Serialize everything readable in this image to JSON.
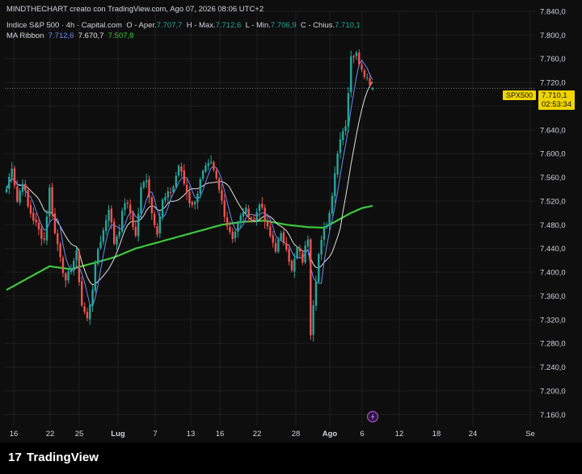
{
  "header": {
    "attribution": "MINDTHECHART creato con TradingView.com, Ago 07, 2026 08:06 UTC+2",
    "symbol": "Indice S&P 500 · 4h · Capital.com",
    "open_label": "O - Aper.",
    "open": "7.707,7",
    "high_label": "H - Max.",
    "high": "7.712,6",
    "low_label": "L - Min.",
    "low": "7.706,9",
    "close_label": "C - Chius.",
    "close": "7.710,1",
    "ma_label": "MA Ribbon",
    "ma1": "7.712,6",
    "ma2": "7.670,7",
    "ma3": "7.507,8"
  },
  "price_tag": {
    "ticker": "SPX500",
    "price": "7.710,1",
    "countdown": "02:53:34"
  },
  "footer": {
    "brand": "TradingView",
    "brand_mark": "17"
  },
  "colors": {
    "up": "#26a69a",
    "down": "#ef5350",
    "ma_fast": "#6c8cf5",
    "ma_mid": "#e0e0e0",
    "ma_slow": "#3cc83c",
    "tag": "#f0d400"
  },
  "chart_data": {
    "type": "candlestick",
    "ylim": [
      7140,
      7840
    ],
    "y_ticks": [
      "7.840,0",
      "7.800,0",
      "7.760,0",
      "7.720,0",
      "7.680,0",
      "7.640,0",
      "7.600,0",
      "7.560,0",
      "7.520,0",
      "7.480,0",
      "7.440,0",
      "7.400,0",
      "7.360,0",
      "7.320,0",
      "7.280,0",
      "7.240,0",
      "7.200,0",
      "7.160,0"
    ],
    "y_tick_values": [
      7840,
      7800,
      7760,
      7720,
      7680,
      7640,
      7600,
      7560,
      7520,
      7480,
      7440,
      7400,
      7360,
      7320,
      7280,
      7240,
      7200,
      7160
    ],
    "x_ticks": [
      "16",
      "22",
      "25",
      "Lug",
      "7",
      "13",
      "16",
      "22",
      "28",
      "Ago",
      "6",
      "12",
      "18",
      "24",
      "Se"
    ],
    "grid": true,
    "price_line": 7710.1,
    "anchors": [
      [
        0,
        7540
      ],
      [
        2,
        7580
      ],
      [
        4,
        7520
      ],
      [
        6,
        7555
      ],
      [
        8,
        7510
      ],
      [
        10,
        7490
      ],
      [
        12,
        7470
      ],
      [
        14,
        7455
      ],
      [
        16,
        7540
      ],
      [
        18,
        7465
      ],
      [
        20,
        7430
      ],
      [
        22,
        7380
      ],
      [
        24,
        7410
      ],
      [
        26,
        7430
      ],
      [
        28,
        7345
      ],
      [
        30,
        7320
      ],
      [
        32,
        7375
      ],
      [
        34,
        7440
      ],
      [
        36,
        7470
      ],
      [
        38,
        7510
      ],
      [
        40,
        7450
      ],
      [
        42,
        7475
      ],
      [
        44,
        7520
      ],
      [
        46,
        7500
      ],
      [
        48,
        7460
      ],
      [
        50,
        7540
      ],
      [
        52,
        7560
      ],
      [
        54,
        7500
      ],
      [
        56,
        7470
      ],
      [
        58,
        7520
      ],
      [
        60,
        7530
      ],
      [
        62,
        7545
      ],
      [
        64,
        7580
      ],
      [
        66,
        7550
      ],
      [
        68,
        7520
      ],
      [
        70,
        7515
      ],
      [
        72,
        7560
      ],
      [
        74,
        7575
      ],
      [
        76,
        7580
      ],
      [
        78,
        7555
      ],
      [
        80,
        7520
      ],
      [
        82,
        7480
      ],
      [
        84,
        7460
      ],
      [
        86,
        7480
      ],
      [
        88,
        7505
      ],
      [
        90,
        7500
      ],
      [
        92,
        7485
      ],
      [
        94,
        7520
      ],
      [
        96,
        7485
      ],
      [
        98,
        7460
      ],
      [
        100,
        7440
      ],
      [
        102,
        7460
      ],
      [
        104,
        7445
      ],
      [
        106,
        7400
      ],
      [
        108,
        7440
      ],
      [
        110,
        7420
      ],
      [
        112,
        7460
      ],
      [
        113,
        7300
      ],
      [
        114,
        7350
      ],
      [
        116,
        7430
      ],
      [
        118,
        7470
      ],
      [
        120,
        7500
      ],
      [
        122,
        7570
      ],
      [
        124,
        7630
      ],
      [
        126,
        7650
      ],
      [
        128,
        7760
      ],
      [
        130,
        7775
      ],
      [
        132,
        7740
      ],
      [
        134,
        7730
      ],
      [
        136,
        7710
      ]
    ],
    "ma_slow_anchors": [
      [
        0,
        7370
      ],
      [
        8,
        7390
      ],
      [
        16,
        7410
      ],
      [
        24,
        7405
      ],
      [
        32,
        7415
      ],
      [
        40,
        7425
      ],
      [
        48,
        7440
      ],
      [
        56,
        7450
      ],
      [
        64,
        7460
      ],
      [
        72,
        7470
      ],
      [
        80,
        7480
      ],
      [
        88,
        7485
      ],
      [
        96,
        7487
      ],
      [
        104,
        7480
      ],
      [
        112,
        7476
      ],
      [
        118,
        7475
      ],
      [
        122,
        7485
      ],
      [
        128,
        7500
      ],
      [
        132,
        7508
      ],
      [
        136,
        7512
      ]
    ],
    "candle_count": 137,
    "ma_fast_value": 7712.6,
    "ma_mid_value": 7670.7,
    "ma_slow_value": 7507.8,
    "last_open": 7707.7,
    "last_high": 7712.6,
    "last_low": 7706.9,
    "last_close": 7710.1
  }
}
